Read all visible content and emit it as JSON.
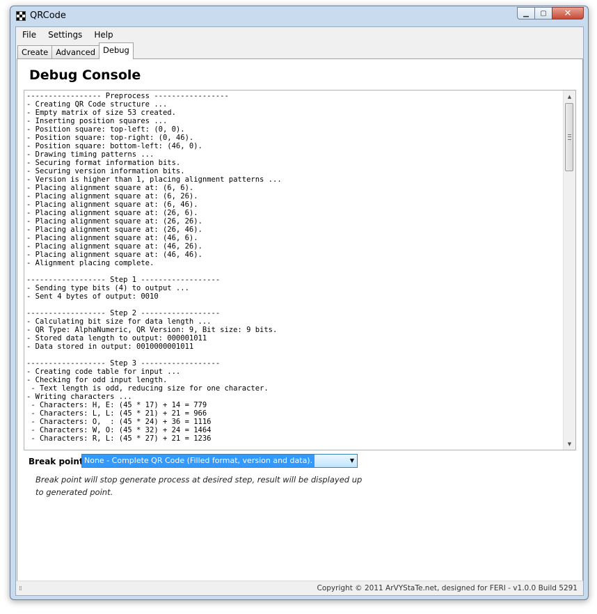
{
  "window": {
    "title": "QRCode"
  },
  "menu": [
    "File",
    "Settings",
    "Help"
  ],
  "tabs": [
    "Create",
    "Advanced",
    "Debug"
  ],
  "active_tab": "Debug",
  "page": {
    "title": "Debug Console"
  },
  "console": {
    "text": "----------------- Preprocess -----------------\n- Creating QR Code structure ...\n- Empty matrix of size 53 created.\n- Inserting position squares ...\n- Position square: top-left: (0, 0).\n- Position square: top-right: (0, 46).\n- Position square: bottom-left: (46, 0).\n- Drawing timing patterns ...\n- Securing format information bits.\n- Securing version information bits.\n- Version is higher than 1, placing alignment patterns ...\n- Placing alignment square at: (6, 6).\n- Placing alignment square at: (6, 26).\n- Placing alignment square at: (6, 46).\n- Placing alignment square at: (26, 6).\n- Placing alignment square at: (26, 26).\n- Placing alignment square at: (26, 46).\n- Placing alignment square at: (46, 6).\n- Placing alignment square at: (46, 26).\n- Placing alignment square at: (46, 46).\n- Alignment placing complete.\n\n------------------ Step 1 ------------------\n- Sending type bits (4) to output ...\n- Sent 4 bytes of output: 0010\n\n------------------ Step 2 ------------------\n- Calculating bit size for data length ...\n- QR Type: AlphaNumeric, QR Version: 9, Bit size: 9 bits.\n- Stored data length to output: 000001011\n- Data stored in output: 0010000001011\n\n------------------ Step 3 ------------------\n- Creating code table for input ...\n- Checking for odd input length.\n - Text length is odd, reducing size for one character.\n- Writing characters ...\n - Characters: H, E: (45 * 17) + 14 = 779\n - Characters: L, L: (45 * 21) + 21 = 966\n - Characters: O,  : (45 * 24) + 36 = 1116\n - Characters: W, O: (45 * 32) + 24 = 1464\n - Characters: R, L: (45 * 27) + 21 = 1236"
  },
  "break_point": {
    "label": "Break point:",
    "selected": "None - Complete QR Code (Filled format, version and data).",
    "note": "Break point will stop generate process at desired step, result will be displayed up to generated point."
  },
  "status": {
    "text": "Copyright © 2011 ArVYStaTe.net, designed for FERI - v1.0.0 Build 5291"
  },
  "icons": {
    "app": "qr-code-icon",
    "minimize": "minimize-icon",
    "maximize": "maximize-icon",
    "close": "close-icon",
    "scroll_up": "scroll-up-arrow-icon",
    "scroll_down": "scroll-down-arrow-icon",
    "dropdown": "chevron-down-icon",
    "resize_grip": "resize-grip-icon"
  },
  "colors": {
    "accent": "#3399ff",
    "window_frame": "#c9dbee",
    "close_button": "#c74a36"
  }
}
